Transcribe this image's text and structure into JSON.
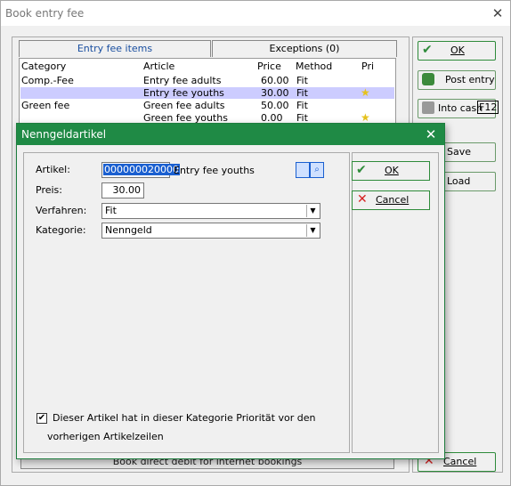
{
  "outer": {
    "title": "Book entry fee",
    "close_glyph": "✕",
    "tabs": [
      "Entry fee items",
      "Exceptions (0)"
    ],
    "list": {
      "headers": [
        "Category",
        "Article",
        "Price",
        "Method",
        "Pri"
      ],
      "rows": [
        {
          "category": "Comp.-Fee",
          "article": "Entry fee adults",
          "price": "60.00",
          "method": "Fit",
          "pri": ""
        },
        {
          "category": "",
          "article": "Entry fee youths",
          "price": "30.00",
          "method": "Fit",
          "pri": "★"
        },
        {
          "category": "Green fee",
          "article": "Green fee adults",
          "price": "50.00",
          "method": "Fit",
          "pri": ""
        },
        {
          "category": "",
          "article": "Green fee youths",
          "price": "0.00",
          "method": "Fit",
          "pri": "★"
        }
      ]
    },
    "buttons": {
      "ok": "OK",
      "post_entry": "Post entry",
      "into_cash": "Into cash",
      "into_cash_key": "F12",
      "save": "Save",
      "load": "Load",
      "cancel": "Cancel"
    },
    "bottom_bar": "Book direct debit for internet bookings"
  },
  "dialog": {
    "title": "Nenngeldartikel",
    "close_glyph": "✕",
    "artikel_label": "Artikel:",
    "artikel_value": "000000020000",
    "artikel_name": "Entry fee youths",
    "preis_label": "Preis:",
    "preis_value": "30.00",
    "verfahren_label": "Verfahren:",
    "verfahren_value": "Fit",
    "kategorie_label": "Kategorie:",
    "kategorie_value": "Nenngeld",
    "ok_label": "OK",
    "cancel_label": "Cancel",
    "checkbox_checked": "✔",
    "checkbox_line1": "Dieser Artikel hat in dieser Kategorie Priorität vor den",
    "checkbox_line2": "vorherigen Artikelzeilen"
  },
  "colors": {
    "dialog_title_bg": "#1f8a45",
    "selection_bg": "#ccccff",
    "button_border": "#2e8b3a",
    "cancel_icon": "#d62020"
  }
}
